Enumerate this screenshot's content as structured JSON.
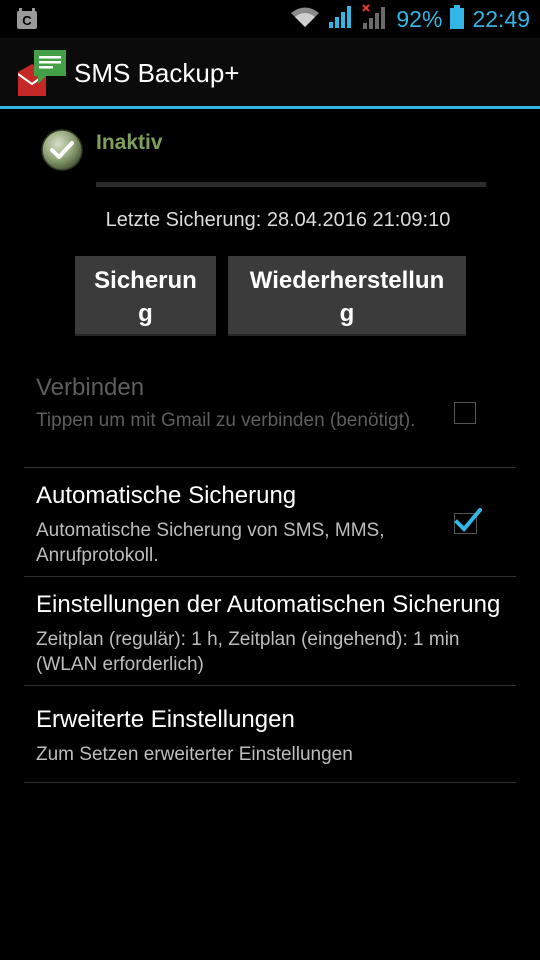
{
  "status_bar": {
    "battery_percent": "92%",
    "time": "22:49",
    "icons": [
      "cyanogen-notification-icon",
      "wifi-icon",
      "signal-icon",
      "signal-no-data-icon",
      "battery-icon"
    ]
  },
  "action_bar": {
    "title": "SMS Backup+",
    "app_icon": "sms-backup-app-icon"
  },
  "status": {
    "label": "Inaktiv",
    "icon": "check-icon",
    "last_backup": "Letzte Sicherung: 28.04.2016 21:09:10"
  },
  "buttons": {
    "backup": {
      "line1": "Sicherun",
      "line2": "g"
    },
    "restore": {
      "line1": "Wiederherstellun",
      "line2": "g"
    }
  },
  "preferences": [
    {
      "title": "Verbinden",
      "summary": "Tippen um mit Gmail zu verbinden (benötigt).",
      "checkbox": true,
      "checked": false,
      "enabled": false
    },
    {
      "title": "Automatische Sicherung",
      "summary": "Automatische Sicherung von SMS, MMS, Anrufprotokoll.",
      "checkbox": true,
      "checked": true,
      "enabled": true
    },
    {
      "title": "Einstellungen der Automatischen Sicherung",
      "summary": "Zeitplan (regulär): 1 h, Zeitplan (eingehend): 1 min (WLAN erforderlich)",
      "checkbox": false,
      "enabled": true
    },
    {
      "title": "Erweiterte Einstellungen",
      "summary": "Zum Setzen erweiterter Einstellungen",
      "checkbox": false,
      "enabled": true
    }
  ],
  "colors": {
    "accent": "#33b5e5",
    "status_label": "#7fa05a",
    "button_bg": "#3b3b3b"
  }
}
